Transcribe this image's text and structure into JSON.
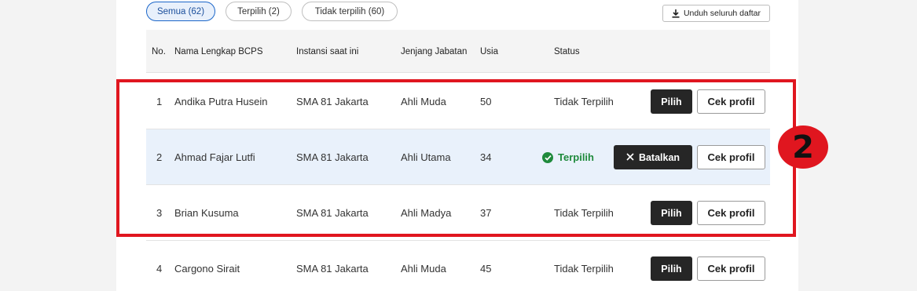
{
  "filters": [
    {
      "label": "Semua (62)",
      "active": true
    },
    {
      "label": "Terpilih (2)",
      "active": false
    },
    {
      "label": "Tidak terpilih (60)",
      "active": false
    }
  ],
  "download_label": "Unduh seluruh daftar",
  "columns": [
    "No.",
    "Nama Lengkap BCPS",
    "Instansi saat ini",
    "Jenjang Jabatan",
    "Usia",
    "Status"
  ],
  "rows": [
    {
      "no": "1",
      "name": "Andika Putra Husein",
      "instansi": "SMA 81 Jakarta",
      "jenjang": "Ahli Muda",
      "usia": "50",
      "status": "Tidak Terpilih",
      "action": "Pilih",
      "profile": "Cek profil"
    },
    {
      "no": "2",
      "name": "Ahmad Fajar Lutfi",
      "instansi": "SMA 81 Jakarta",
      "jenjang": "Ahli Utama",
      "usia": "34",
      "status": "Terpilih",
      "action": "Batalkan",
      "profile": "Cek profil"
    },
    {
      "no": "3",
      "name": "Brian Kusuma",
      "instansi": "SMA 81 Jakarta",
      "jenjang": "Ahli Madya",
      "usia": "37",
      "status": "Tidak Terpilih",
      "action": "Pilih",
      "profile": "Cek profil"
    },
    {
      "no": "4",
      "name": "Cargono Sirait",
      "instansi": "SMA 81 Jakarta",
      "jenjang": "Ahli Muda",
      "usia": "45",
      "status": "Tidak Terpilih",
      "action": "Pilih",
      "profile": "Cek profil"
    }
  ],
  "annotation": {
    "step_number": "2",
    "color": "#e0161f"
  },
  "colors": {
    "selected_status": "#1f8a3c",
    "selected_row_bg": "#e9f1fb",
    "active_chip": "#1b66c9"
  }
}
